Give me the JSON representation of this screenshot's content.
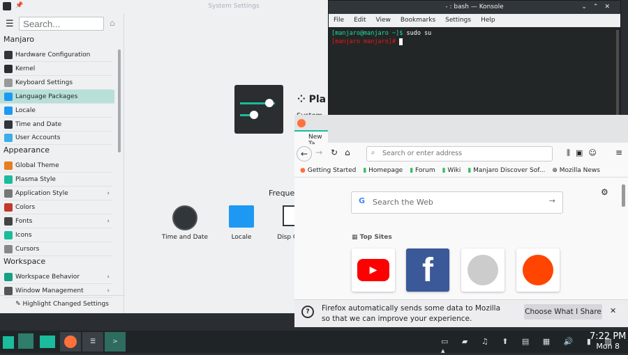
{
  "settings": {
    "title": "System Settings",
    "search_placeholder": "Search...",
    "page_title": "Pla",
    "page_subtitle": "System",
    "frequent_title": "Freque",
    "groups": [
      {
        "label": "Manjaro",
        "items": [
          "Hardware Configuration",
          "Kernel",
          "Keyboard Settings",
          "Language Packages",
          "Locale",
          "Time and Date",
          "User Accounts"
        ]
      },
      {
        "label": "Appearance",
        "items": [
          "Global Theme",
          "Plasma Style",
          "Application Style",
          "Colors",
          "Fonts",
          "Icons",
          "Cursors"
        ]
      },
      {
        "label": "Workspace",
        "items": [
          "Workspace Behavior",
          "Window Management"
        ]
      }
    ],
    "selected": "Language Packages",
    "frequent": [
      "Time and Date",
      "Locale",
      "Disp Config"
    ],
    "highlight_label": "Highlight Changed Settings"
  },
  "konsole": {
    "title": "- : bash — Konsole",
    "menu": [
      "File",
      "Edit",
      "View",
      "Bookmarks",
      "Settings",
      "Help"
    ],
    "line1_prompt": "[manjaro@manjaro ~]$",
    "line1_cmd": " sudo su",
    "line2_prompt": "[manjaro manjaro]#"
  },
  "firefox": {
    "tab": "New Ta",
    "address_placeholder": "Search or enter address",
    "bookmarks": [
      "Getting Started",
      "Homepage",
      "Forum",
      "Wiki",
      "Manjaro Discover Sof...",
      "Mozilla News"
    ],
    "search_placeholder": "Search the Web",
    "top_sites": "Top Sites",
    "notice": "Firefox automatically sends some data to Mozilla so that we can improve your experience.",
    "choose_button": "Choose What I Share"
  },
  "taskbar": {
    "time": "7:22 PM",
    "date": "Mon 8"
  },
  "colors": {
    "accent": "#1abc9c",
    "selection": "#b7e0d9"
  }
}
